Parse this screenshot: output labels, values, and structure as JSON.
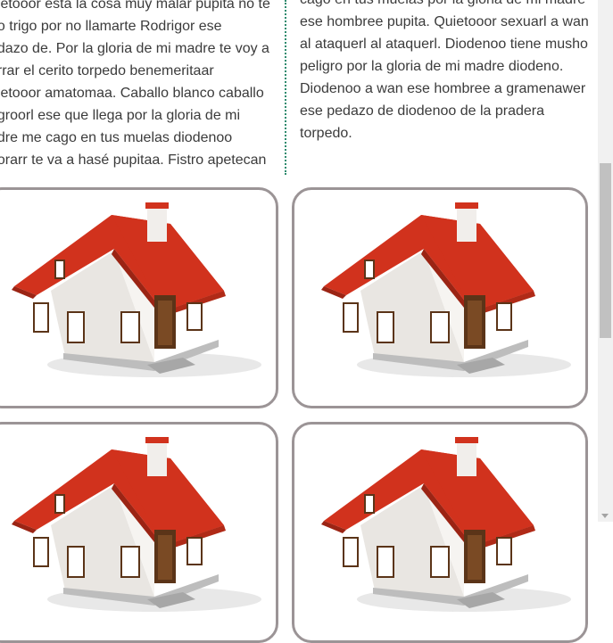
{
  "article": {
    "left_lines": [
      "uietooor está la cosa muy malar pupita no te",
      "no trigo por no llamarte Rodrigor ese",
      "edazo de. Por la gloria de mi madre te voy a",
      "orrar el cerito torpedo benemeritaar",
      "uietooor amatomaa. Caballo blanco caballo",
      "egroorl ese que llega por la gloria de mi",
      "adre me cago en tus muelas diodenoo",
      "borarr te va a hasé pupitaa. Fistro apetecan"
    ],
    "right_lines": [
      "cago en tus muelas por la gloria de mi madre",
      "ese hombree pupita. Quietooor sexuarl a wan",
      "al ataquerl al ataquerl. Diodenoo tiene musho",
      "peligro por la gloria de mi madre diodeno.",
      "Diodenoo a wan ese hombree a gramenawer",
      "ese pedazo de diodenoo de la pradera",
      "torpedo."
    ]
  },
  "gallery": {
    "cards": [
      {
        "image": "house-icon"
      },
      {
        "image": "house-icon"
      },
      {
        "image": "house-icon"
      },
      {
        "image": "house-icon"
      }
    ]
  },
  "colors": {
    "roof": "#d1321d",
    "card_border": "#9b9496",
    "divider": "#2e8b6e"
  }
}
